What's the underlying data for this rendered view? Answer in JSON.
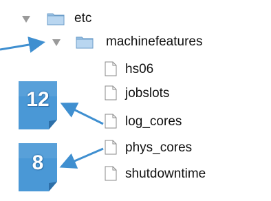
{
  "tree": {
    "items": [
      {
        "label": "etc",
        "type": "folder",
        "expanded": true,
        "icon": "folder-icon"
      },
      {
        "label": "machinefeatures",
        "type": "folder",
        "expanded": true,
        "icon": "folder-icon"
      },
      {
        "label": "hs06",
        "type": "file",
        "icon": "document-icon"
      },
      {
        "label": "jobslots",
        "type": "file",
        "icon": "document-icon"
      },
      {
        "label": "log_cores",
        "type": "file",
        "icon": "document-icon"
      },
      {
        "label": "phys_cores",
        "type": "file",
        "icon": "document-icon"
      },
      {
        "label": "shutdowntime",
        "type": "file",
        "icon": "document-icon"
      }
    ]
  },
  "callouts": [
    {
      "value": "12",
      "points_to": "log_cores"
    },
    {
      "value": "8",
      "points_to": "phys_cores"
    }
  ],
  "colors": {
    "callout_fill": "#4a98d6",
    "arrow": "#3f8fd0",
    "folder": "#9cc3e6",
    "disclosure_triangle": "#9a9a9a"
  }
}
